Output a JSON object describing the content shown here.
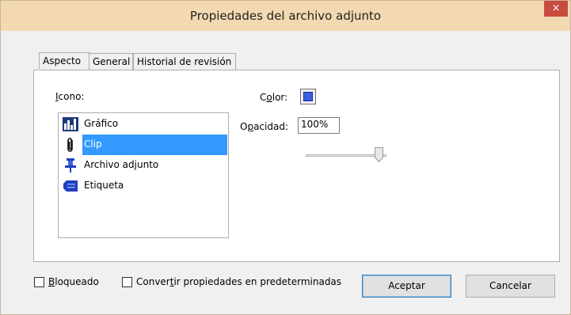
{
  "window": {
    "title": "Propiedades del archivo adjunto",
    "close_glyph": "×"
  },
  "tabs": [
    {
      "label": "Aspecto",
      "active": true
    },
    {
      "label": "General",
      "active": false
    },
    {
      "label": "Historial de revisión",
      "active": false
    }
  ],
  "appearance": {
    "icon_label_underlined": "I",
    "icon_label_rest": "cono:",
    "icon_list": [
      {
        "label": "Gráfico",
        "icon": "graph-icon",
        "selected": false
      },
      {
        "label": "Clip",
        "icon": "paperclip-icon",
        "selected": true
      },
      {
        "label": "Archivo adjunto",
        "icon": "pushpin-icon",
        "selected": false
      },
      {
        "label": "Etiqueta",
        "icon": "tag-icon",
        "selected": false
      }
    ],
    "color_label_pre": "C",
    "color_label_underlined": "o",
    "color_label_post": "lor:",
    "color_value": "#3a5fe0",
    "opacity_label_pre": "O",
    "opacity_label_underlined": "p",
    "opacity_label_post": "acidad:",
    "opacity_value": "100%",
    "opacity_fraction": 1.0
  },
  "footer": {
    "locked_underlined": "B",
    "locked_rest": "loqueado",
    "defaults_pre": "Conver",
    "defaults_underlined": "t",
    "defaults_post": "ir propiedades en predeterminadas",
    "ok_label": "Aceptar",
    "cancel_label": "Cancelar"
  },
  "colors": {
    "titlebar": "#f3d9b1",
    "close_button": "#c94b40",
    "selection": "#3399ff"
  }
}
